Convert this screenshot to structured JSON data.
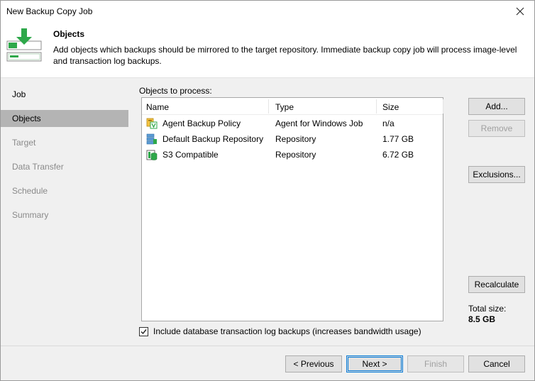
{
  "window": {
    "title": "New Backup Copy Job"
  },
  "header": {
    "title": "Objects",
    "description": "Add objects which backups should be mirrored to the target repository. Immediate backup copy job will process image-level and transaction log backups."
  },
  "sidebar": {
    "items": [
      {
        "label": "Job",
        "state": "done"
      },
      {
        "label": "Objects",
        "state": "active"
      },
      {
        "label": "Target",
        "state": "pending"
      },
      {
        "label": "Data Transfer",
        "state": "pending"
      },
      {
        "label": "Schedule",
        "state": "pending"
      },
      {
        "label": "Summary",
        "state": "pending"
      }
    ]
  },
  "objects": {
    "label": "Objects to process:",
    "columns": [
      "Name",
      "Type",
      "Size"
    ],
    "rows": [
      {
        "icon": "agent-policy-icon",
        "name": "Agent Backup Policy",
        "type": "Agent for Windows Job",
        "size": "n/a"
      },
      {
        "icon": "backup-repository-icon",
        "name": "Default Backup Repository",
        "type": "Repository",
        "size": "1.77 GB"
      },
      {
        "icon": "s3-repository-icon",
        "name": "S3 Compatible",
        "type": "Repository",
        "size": "6.72 GB"
      }
    ]
  },
  "side_buttons": {
    "add": "Add...",
    "remove": "Remove",
    "exclusions": "Exclusions...",
    "recalculate": "Recalculate"
  },
  "total": {
    "label": "Total size:",
    "value": "8.5 GB"
  },
  "option": {
    "checked": true,
    "label": "Include database transaction log backups (increases bandwidth usage)"
  },
  "footer": {
    "previous": "< Previous",
    "next": "Next >",
    "finish": "Finish",
    "cancel": "Cancel"
  },
  "colors": {
    "accent": "#0078d7",
    "active_nav": "#b4b4b4",
    "icon_green": "#2ea84a"
  }
}
